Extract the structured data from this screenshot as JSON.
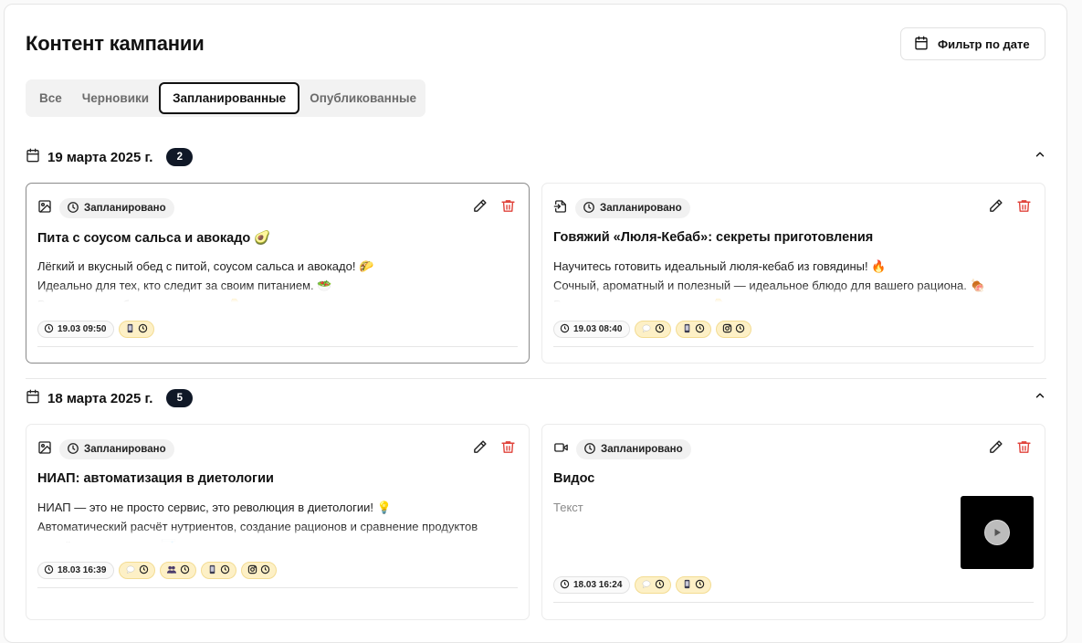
{
  "page": {
    "title": "Контент кампании",
    "filter_label": "Фильтр по дате"
  },
  "tabs": [
    {
      "label": "Все",
      "active": false
    },
    {
      "label": "Черновики",
      "active": false
    },
    {
      "label": "Запланированные",
      "active": true
    },
    {
      "label": "Опубликованные",
      "active": false
    }
  ],
  "groups": [
    {
      "date": "19 марта 2025 г.",
      "count": "2",
      "cards": [
        {
          "type_icon": "image-icon",
          "status": "Запланировано",
          "title": "Пита с соусом сальса и авокадо 🥑",
          "lines": [
            "Лёгкий и вкусный обед с питой, соусом сальса и авокадо! 🌮",
            "Идеально для тех, кто следит за своим питанием. 🥗",
            "Рецепт и подробности в карточке. 👇"
          ],
          "time": "19.03 09:50",
          "platforms": [
            "phone-icon"
          ]
        },
        {
          "type_icon": "file-import-icon",
          "status": "Запланировано",
          "title": "Говяжий «Люля-Кебаб»: секреты приготовления",
          "lines": [
            "Научитесь готовить идеальный люля-кебаб из говядины! 🔥",
            "Сочный, ароматный и полезный — идеальное блюдо для вашего рациона. 🍖",
            "Рецепт и советы в карточке. 👇"
          ],
          "time": "19.03 08:40",
          "platforms": [
            "chat-icon",
            "phone-icon",
            "instagram-icon"
          ]
        }
      ]
    },
    {
      "date": "18 марта 2025 г.",
      "count": "5",
      "cards": [
        {
          "type_icon": "image-icon",
          "status": "Запланировано",
          "title": "НИАП: автоматизация в диетологии",
          "lines": [
            "НИАП — это не просто сервис, это революция в диетологии! 💡",
            "Автоматический расчёт нутриентов, создание рационов и сравнение продуктов",
            "— всё в одном месте. 📊"
          ],
          "time": "18.03 16:39",
          "platforms": [
            "chat-icon",
            "group-icon",
            "phone-icon",
            "instagram-icon"
          ]
        },
        {
          "type_icon": "video-icon",
          "status": "Запланировано",
          "title": "Видос",
          "lines": [
            "Текст"
          ],
          "time": "18.03 16:24",
          "platforms": [
            "chat-icon",
            "phone-icon"
          ]
        }
      ]
    }
  ]
}
